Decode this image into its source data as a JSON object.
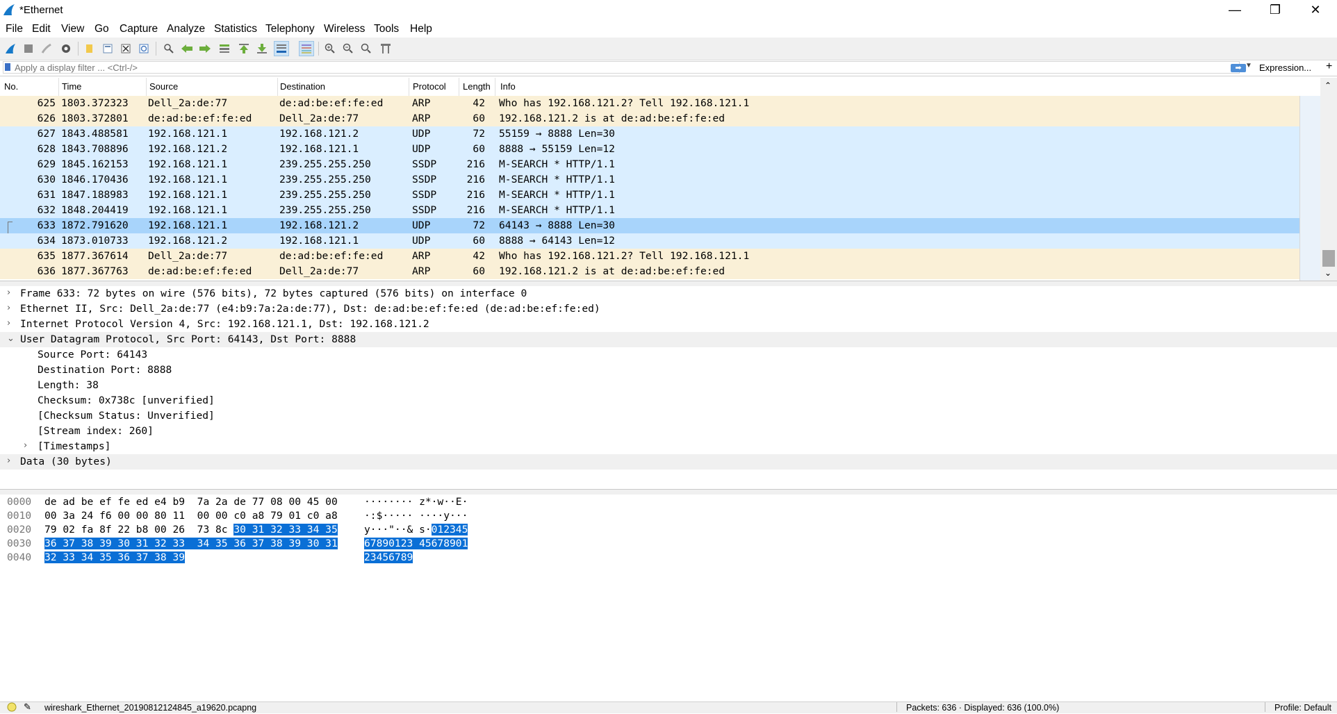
{
  "window": {
    "title": "*Ethernet",
    "minimize": "—",
    "restore": "❐",
    "close": "✕"
  },
  "menu": [
    "File",
    "Edit",
    "View",
    "Go",
    "Capture",
    "Analyze",
    "Statistics",
    "Telephony",
    "Wireless",
    "Tools",
    "Help"
  ],
  "toolbar": {
    "icons": [
      "start-capture",
      "stop-capture",
      "restart-capture",
      "capture-options",
      "open-file",
      "save-file",
      "close-file",
      "reload-file",
      "find-packet",
      "go-back",
      "go-forward",
      "go-to-packet",
      "go-first",
      "go-last",
      "auto-scroll",
      "colorize",
      "zoom-in",
      "zoom-out",
      "zoom-normal",
      "resize-columns"
    ]
  },
  "filter": {
    "placeholder": "Apply a display filter ... <Ctrl-/>",
    "value": "",
    "expression_label": "Expression...",
    "add_label": "+"
  },
  "packet_list": {
    "columns": [
      "No.",
      "Time",
      "Source",
      "Destination",
      "Protocol",
      "Length",
      "Info"
    ],
    "rows": [
      {
        "no": "625",
        "time": "1803.372323",
        "src": "Dell_2a:de:77",
        "dst": "de:ad:be:ef:fe:ed",
        "proto": "ARP",
        "len": "42",
        "info": "Who has 192.168.121.2? Tell 192.168.121.1",
        "color": "#faf0d7"
      },
      {
        "no": "626",
        "time": "1803.372801",
        "src": "de:ad:be:ef:fe:ed",
        "dst": "Dell_2a:de:77",
        "proto": "ARP",
        "len": "60",
        "info": "192.168.121.2 is at de:ad:be:ef:fe:ed",
        "color": "#faf0d7"
      },
      {
        "no": "627",
        "time": "1843.488581",
        "src": "192.168.121.1",
        "dst": "192.168.121.2",
        "proto": "UDP",
        "len": "72",
        "info": "55159 → 8888 Len=30",
        "color": "#daeeff"
      },
      {
        "no": "628",
        "time": "1843.708896",
        "src": "192.168.121.2",
        "dst": "192.168.121.1",
        "proto": "UDP",
        "len": "60",
        "info": "8888 → 55159 Len=12",
        "color": "#daeeff"
      },
      {
        "no": "629",
        "time": "1845.162153",
        "src": "192.168.121.1",
        "dst": "239.255.255.250",
        "proto": "SSDP",
        "len": "216",
        "info": "M-SEARCH * HTTP/1.1",
        "color": "#daeeff"
      },
      {
        "no": "630",
        "time": "1846.170436",
        "src": "192.168.121.1",
        "dst": "239.255.255.250",
        "proto": "SSDP",
        "len": "216",
        "info": "M-SEARCH * HTTP/1.1",
        "color": "#daeeff"
      },
      {
        "no": "631",
        "time": "1847.188983",
        "src": "192.168.121.1",
        "dst": "239.255.255.250",
        "proto": "SSDP",
        "len": "216",
        "info": "M-SEARCH * HTTP/1.1",
        "color": "#daeeff"
      },
      {
        "no": "632",
        "time": "1848.204419",
        "src": "192.168.121.1",
        "dst": "239.255.255.250",
        "proto": "SSDP",
        "len": "216",
        "info": "M-SEARCH * HTTP/1.1",
        "color": "#daeeff"
      },
      {
        "no": "633",
        "time": "1872.791620",
        "src": "192.168.121.1",
        "dst": "192.168.121.2",
        "proto": "UDP",
        "len": "72",
        "info": "64143 → 8888 Len=30",
        "color": "#a8d4fb",
        "selected": true
      },
      {
        "no": "634",
        "time": "1873.010733",
        "src": "192.168.121.2",
        "dst": "192.168.121.1",
        "proto": "UDP",
        "len": "60",
        "info": "8888 → 64143 Len=12",
        "color": "#daeeff"
      },
      {
        "no": "635",
        "time": "1877.367614",
        "src": "Dell_2a:de:77",
        "dst": "de:ad:be:ef:fe:ed",
        "proto": "ARP",
        "len": "42",
        "info": "Who has 192.168.121.2? Tell 192.168.121.1",
        "color": "#faf0d7"
      },
      {
        "no": "636",
        "time": "1877.367763",
        "src": "de:ad:be:ef:fe:ed",
        "dst": "Dell_2a:de:77",
        "proto": "ARP",
        "len": "60",
        "info": "192.168.121.2 is at de:ad:be:ef:fe:ed",
        "color": "#faf0d7"
      }
    ]
  },
  "details": [
    {
      "text": "Frame 633: 72 bytes on wire (576 bits), 72 bytes captured (576 bits) on interface 0",
      "arrow": "›",
      "level": 0,
      "bg": "#ffffff"
    },
    {
      "text": "Ethernet II, Src: Dell_2a:de:77 (e4:b9:7a:2a:de:77), Dst: de:ad:be:ef:fe:ed (de:ad:be:ef:fe:ed)",
      "arrow": "›",
      "level": 0,
      "bg": "#ffffff"
    },
    {
      "text": "Internet Protocol Version 4, Src: 192.168.121.1, Dst: 192.168.121.2",
      "arrow": "›",
      "level": 0,
      "bg": "#ffffff"
    },
    {
      "text": "User Datagram Protocol, Src Port: 64143, Dst Port: 8888",
      "arrow": "⌄",
      "level": 0,
      "bg": "#f0f0f0"
    },
    {
      "text": "Source Port: 64143",
      "arrow": "",
      "level": 1,
      "bg": "#ffffff"
    },
    {
      "text": "Destination Port: 8888",
      "arrow": "",
      "level": 1,
      "bg": "#ffffff"
    },
    {
      "text": "Length: 38",
      "arrow": "",
      "level": 1,
      "bg": "#ffffff"
    },
    {
      "text": "Checksum: 0x738c [unverified]",
      "arrow": "",
      "level": 1,
      "bg": "#ffffff"
    },
    {
      "text": "[Checksum Status: Unverified]",
      "arrow": "",
      "level": 1,
      "bg": "#ffffff"
    },
    {
      "text": "[Stream index: 260]",
      "arrow": "",
      "level": 1,
      "bg": "#ffffff"
    },
    {
      "text": "[Timestamps]",
      "arrow": "›",
      "level": 1,
      "bg": "#ffffff"
    },
    {
      "text": "Data (30 bytes)",
      "arrow": "›",
      "level": 0,
      "bg": "#f0f0f0"
    }
  ],
  "bytes": [
    {
      "offset": "0000",
      "hex": "de ad be ef fe ed e4 b9  7a 2a de 77 08 00 45 00",
      "hex_hl": "",
      "ascii": "········ z*·w··E·",
      "ascii_hl": ""
    },
    {
      "offset": "0010",
      "hex": "00 3a 24 f6 00 00 80 11  00 00 c0 a8 79 01 c0 a8",
      "hex_hl": "",
      "ascii": "·:$····· ····y···",
      "ascii_hl": ""
    },
    {
      "offset": "0020",
      "hex": "79 02 fa 8f 22 b8 00 26  73 8c ",
      "hex_hl": "30 31 32 33 34 35",
      "ascii": "y···\"··& s·",
      "ascii_hl": "012345"
    },
    {
      "offset": "0030",
      "hex": "",
      "hex_hl": "36 37 38 39 30 31 32 33  34 35 36 37 38 39 30 31",
      "ascii": "",
      "ascii_hl": "67890123 45678901"
    },
    {
      "offset": "0040",
      "hex": "",
      "hex_hl": "32 33 34 35 36 37 38 39",
      "ascii": "",
      "ascii_hl": "23456789"
    }
  ],
  "status": {
    "file": "wireshark_Ethernet_20190812124845_a19620.pcapng",
    "packets": "Packets: 636 · Displayed: 636 (100.0%)",
    "profile": "Profile: Default"
  }
}
